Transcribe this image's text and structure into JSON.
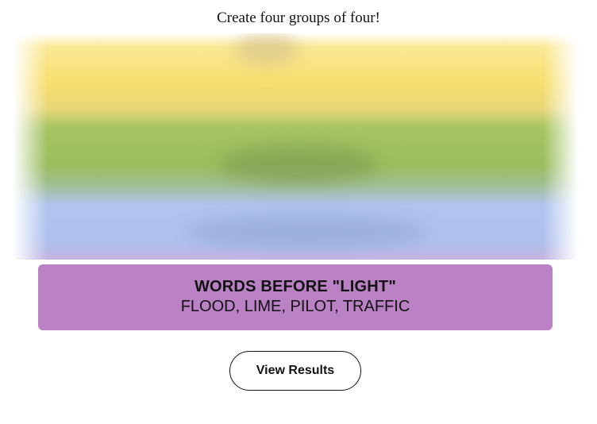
{
  "header": {
    "subtitle": "Create four groups of four!"
  },
  "solved_group": {
    "title": "WORDS BEFORE \"LIGHT\"",
    "members": "FLOOD, LIME, PILOT, TRAFFIC",
    "color": "#ba81c5"
  },
  "board_colors": {
    "yellow": "#f7de6e",
    "green": "#a0c35a",
    "blue": "#b0c4ef",
    "purple": "#ba81c5"
  },
  "actions": {
    "view_results_label": "View Results"
  }
}
